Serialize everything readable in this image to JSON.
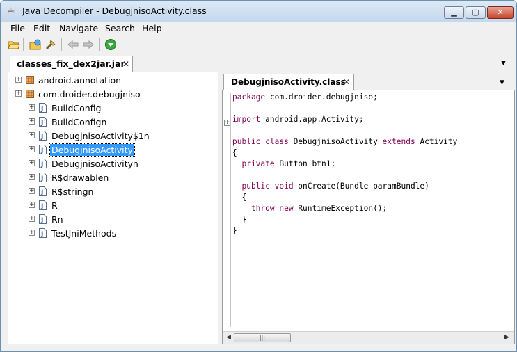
{
  "window": {
    "title": "Java Decompiler - DebugjnisoActivity.class"
  },
  "menu": {
    "items": [
      "File",
      "Edit",
      "Navigate",
      "Search",
      "Help"
    ]
  },
  "toolbar": {
    "icons": [
      "open-file-icon",
      "open-type-icon",
      "find-icon",
      "back-icon",
      "forward-icon",
      "about-icon"
    ]
  },
  "file_tab": {
    "label": "classes_fix_dex2jar.jar"
  },
  "tree": {
    "nodes": [
      {
        "label": "android.annotation",
        "type": "package",
        "level": 0
      },
      {
        "label": "com.droider.debugjniso",
        "type": "package",
        "level": 0
      },
      {
        "label": "BuildConfig",
        "type": "class",
        "level": 1
      },
      {
        "label": "BuildConfign",
        "type": "class",
        "level": 1
      },
      {
        "label": "DebugjnisoActivity$1n",
        "type": "class",
        "level": 1
      },
      {
        "label": "DebugjnisoActivity",
        "type": "class",
        "level": 1,
        "selected": true
      },
      {
        "label": "DebugjnisoActivityn",
        "type": "class",
        "level": 1
      },
      {
        "label": "R$drawablen",
        "type": "class",
        "level": 1
      },
      {
        "label": "R$stringn",
        "type": "class",
        "level": 1
      },
      {
        "label": "R",
        "type": "class",
        "level": 1
      },
      {
        "label": "Rn",
        "type": "class",
        "level": 1
      },
      {
        "label": "TestJniMethods",
        "type": "class",
        "level": 1
      }
    ]
  },
  "editor": {
    "tab_label": "DebugjnisoActivity.class",
    "code": [
      {
        "kw": "package",
        "rest": " com.droider.debugjniso;"
      },
      {
        "kw": "",
        "rest": ""
      },
      {
        "kw": "import",
        "rest": " android.app.Activity;"
      },
      {
        "kw": "",
        "rest": ""
      },
      {
        "kw": "public class",
        "rest": " DebugjnisoActivity ",
        "kw2": "extends",
        "rest2": " Activity"
      },
      {
        "kw": "",
        "rest": "{"
      },
      {
        "kw": "  private",
        "rest": " Button btn1;"
      },
      {
        "kw": "",
        "rest": ""
      },
      {
        "kw": "  public void",
        "rest": " onCreate(Bundle paramBundle)"
      },
      {
        "kw": "",
        "rest": "  {"
      },
      {
        "kw": "    throw new",
        "rest": " RuntimeException();"
      },
      {
        "kw": "",
        "rest": "  }"
      },
      {
        "kw": "",
        "rest": "}"
      }
    ]
  },
  "colors": {
    "keyword": "#7f0055",
    "selection": "#3399ff",
    "title_bar": "#c4d8ee"
  }
}
